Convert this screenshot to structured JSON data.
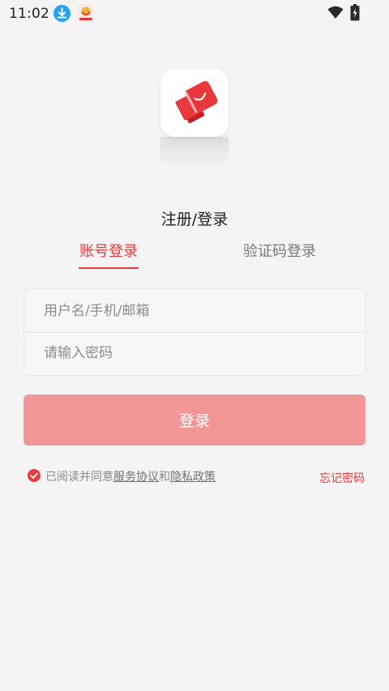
{
  "status_bar": {
    "time": "11:02",
    "icons": [
      "download-icon",
      "app-notification-icon",
      "wifi-icon",
      "battery-charging-icon"
    ]
  },
  "page": {
    "title": "注册/登录"
  },
  "tabs": [
    {
      "label": "账号登录",
      "active": true
    },
    {
      "label": "验证码登录",
      "active": false
    }
  ],
  "form": {
    "username_placeholder": "用户名/手机/邮箱",
    "username_value": "",
    "password_placeholder": "请输入密码",
    "password_value": ""
  },
  "login_button": {
    "label": "登录"
  },
  "agreement": {
    "checked": true,
    "prefix": "已阅读并同意",
    "service_link": "服务协议",
    "connector": "和",
    "privacy_link": "隐私政策"
  },
  "forgot_password": {
    "label": "忘记密码"
  },
  "colors": {
    "accent": "#e83a3a",
    "button": "#f19797",
    "background": "#f4f4f4"
  }
}
